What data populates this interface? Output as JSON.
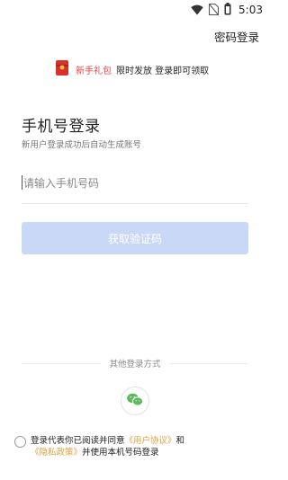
{
  "status_bar": {
    "time": "5:03"
  },
  "header": {
    "password_login": "密码登录"
  },
  "promo": {
    "new_user_gift": "新手礼包",
    "text": "限时发放  登录即可领取"
  },
  "login": {
    "title": "手机号登录",
    "subtitle": "新用户登录成功后自动生成账号",
    "phone_placeholder": "请输入手机号码",
    "get_code_button": "获取验证码"
  },
  "other_login": {
    "label": "其他登录方式"
  },
  "agreement": {
    "prefix": "登录代表你已阅读并同意",
    "user_agreement": "《用户协议》",
    "and": "和",
    "privacy_policy": "《隐私政策》",
    "suffix": "并使用本机号码登录"
  },
  "colors": {
    "accent_red": "#e54646",
    "button_disabled": "#cad8f8",
    "link_orange": "#e0a040",
    "wechat_green": "#5cb85c"
  },
  "icons": [
    "wifi-icon",
    "sim-icon",
    "battery-icon",
    "gift-icon",
    "wechat-icon"
  ]
}
